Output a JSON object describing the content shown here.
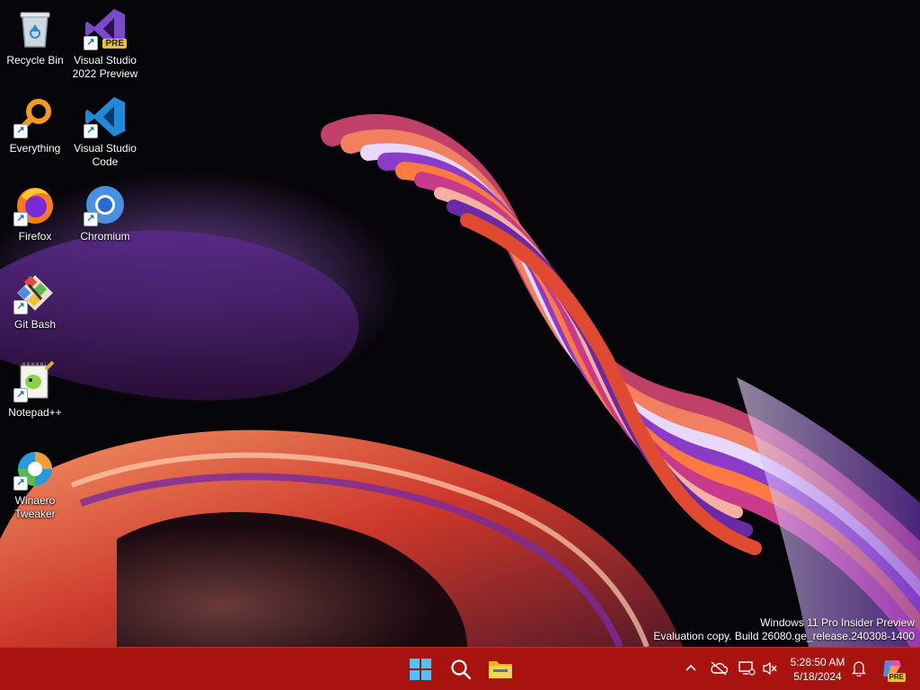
{
  "desktop": {
    "icons": [
      {
        "label": "Recycle Bin",
        "icon": "recycle-bin-icon",
        "shortcut": false
      },
      {
        "label": "Visual Studio\n2022 Preview",
        "icon": "visual-studio-preview-icon",
        "shortcut": true,
        "badge": "PRE"
      },
      {
        "label": "Everything",
        "icon": "everything-search-icon",
        "shortcut": true
      },
      {
        "label": "Visual Studio\nCode",
        "icon": "vscode-icon",
        "shortcut": true
      },
      {
        "label": "Firefox",
        "icon": "firefox-icon",
        "shortcut": true
      },
      {
        "label": "Chromium",
        "icon": "chromium-icon",
        "shortcut": true
      },
      {
        "label": "Git Bash",
        "icon": "git-bash-icon",
        "shortcut": true
      },
      {
        "label": "Notepad++",
        "icon": "notepadpp-icon",
        "shortcut": true
      },
      {
        "label": "Winaero\nTweaker",
        "icon": "winaero-tweaker-icon",
        "shortcut": true
      }
    ]
  },
  "watermark": {
    "line1": "Windows 11 Pro Insider Preview",
    "line2": "Evaluation copy. Build 26080.ge_release.240308-1400"
  },
  "taskbar": {
    "color": "#a8120f",
    "pinned": [
      {
        "name": "start-button",
        "icon": "windows-logo-icon"
      },
      {
        "name": "search-button",
        "icon": "search-icon"
      },
      {
        "name": "file-explorer-button",
        "icon": "folder-icon"
      }
    ],
    "tray": {
      "icons": [
        "chevron-up-icon",
        "onedrive-offline-icon",
        "network-icon",
        "volume-muted-icon"
      ],
      "time": "5:28:50 AM",
      "date": "5/18/2024",
      "notification_icon": "bell-icon",
      "copilot_badge": "PRE"
    }
  }
}
